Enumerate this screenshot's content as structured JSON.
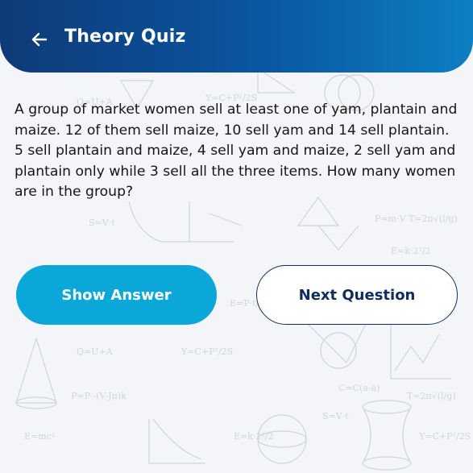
{
  "header": {
    "title": "Theory Quiz",
    "back_icon": "arrow-left-icon",
    "gradient": [
      "#0f3a78",
      "#0d7fc2"
    ]
  },
  "question": {
    "text": "A group of market women sell at least one of yam, plantain and maize. 12 of them sell maize, 10 sell yam and 14 sell plantain. 5 sell plantain and maize, 4 sell yam and maize, 2 sell yam and plantain only while 3 sell all the three items. How many women are in the group?"
  },
  "buttons": {
    "show_answer": "Show Answer",
    "next_question": "Next Question"
  },
  "colors": {
    "accent": "#0aa7d8",
    "navy": "#0f2d5c",
    "background": "#f3f5f8"
  }
}
